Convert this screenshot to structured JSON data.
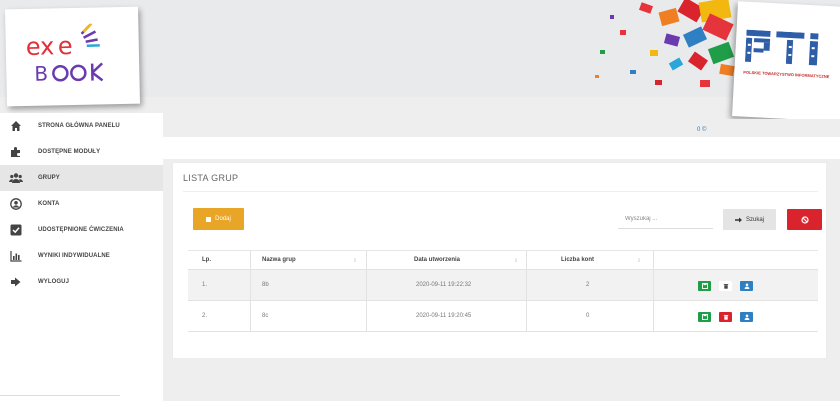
{
  "header": {
    "logo": {
      "text": "exe BOOK",
      "colors": [
        "#e0303a",
        "#6a3ab0",
        "#2aa7d8",
        "#f2b80f"
      ]
    },
    "partner_logo": {
      "text": "PTI",
      "subtitle": "POLSKIE TOWARZYSTWO INFORMATYCZNE",
      "color": "#2f5ea8"
    },
    "counter": "0 ©"
  },
  "sidebar": {
    "items": [
      {
        "label": "STRONA GŁÓWNA PANELU",
        "icon": "home-icon",
        "active": false
      },
      {
        "label": "DOSTĘPNE MODUŁY",
        "icon": "puzzle-icon",
        "active": false
      },
      {
        "label": "GRUPY",
        "icon": "users-icon",
        "active": true
      },
      {
        "label": "KONTA",
        "icon": "user-circle-icon",
        "active": false
      },
      {
        "label": "UDOSTĘPNIONE ĆWICZENIA",
        "icon": "checkbox-icon",
        "active": false
      },
      {
        "label": "WYNIKI INDYWIDUALNE",
        "icon": "bar-chart-icon",
        "active": false
      },
      {
        "label": "WYLOGUJ",
        "icon": "logout-icon",
        "active": false
      }
    ]
  },
  "main": {
    "title": "LISTA GRUP",
    "add_label": "Dodaj",
    "search_placeholder": "Wyszukaj ...",
    "search_label": "Szukaj",
    "columns": [
      "Lp.",
      "Nazwa grup",
      "Data utworzenia",
      "Liczba kont"
    ],
    "rows": [
      {
        "lp": "1.",
        "name": "8b",
        "date": "2020-09-11 19:22:32",
        "count": "2"
      },
      {
        "lp": "2.",
        "name": "8c",
        "date": "2020-09-11 19:20:45",
        "count": "0"
      }
    ]
  },
  "colors": {
    "accent_orange": "#e8a526",
    "danger_red": "#d9232d",
    "success_green": "#1f9d48",
    "info_blue": "#2f7fc3"
  }
}
